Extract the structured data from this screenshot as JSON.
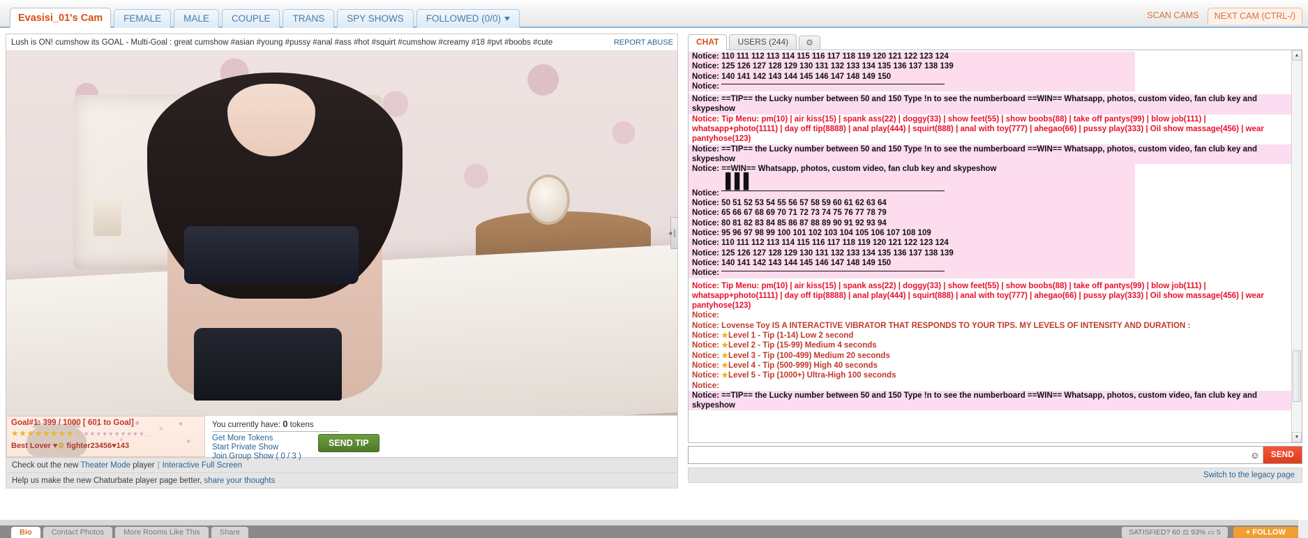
{
  "topbar": {
    "room_tab": "Evasisi_01's Cam",
    "category_tabs": [
      "FEMALE",
      "MALE",
      "COUPLE",
      "TRANS",
      "SPY SHOWS"
    ],
    "followed_tab": "FOLLOWED (0/0)",
    "scan_cams": "SCAN CAMS",
    "next_cam": "NEXT CAM (CTRL-/)"
  },
  "player": {
    "room_subject": "Lush is ON! cumshow its GOAL - Multi-Goal : great cumshow #asian #young #pussy #anal #ass #hot #squirt #cumshow #creamy #18 #pvt #boobs #cute",
    "report_abuse": "REPORT ABUSE",
    "resize_handle_glyph": "◄║►"
  },
  "goal": {
    "label": "Goal#1: 399 / 1000 [ 601 to Goal]",
    "current": 399,
    "target": 1000,
    "remaining": 601,
    "stars_filled": 8,
    "stars_total": 9,
    "stars_text": "★★★★★★★★☆",
    "stars_trail": "▾ ▾ ▾ ▾ ▾ ▾ ▾ ▾ ▾ ▾ ...",
    "best_lover_prefix": "Best Lover ♥",
    "best_lover_crown": "♔",
    "best_lover_name": "fighter23456♥143"
  },
  "tokens": {
    "balance_prefix": "You currently have:",
    "balance": "0",
    "balance_suffix": "tokens",
    "links": [
      "Get More Tokens",
      "Start Private Show",
      "Join Group Show ( 0 / 3 )"
    ],
    "send_tip": "SEND TIP"
  },
  "footer": {
    "theater_prefix": "Check out the new",
    "theater_link": "Theater Mode",
    "theater_suffix": "player",
    "separator": "|",
    "fullscreen_link": "Interactive Full Screen",
    "feedback_prefix": "Help us make the new Chaturbate player page better,",
    "feedback_link": "share your thoughts",
    "switch_legacy": "Switch to the legacy page"
  },
  "chat": {
    "tabs": [
      {
        "label": "CHAT",
        "active": true
      },
      {
        "label": "USERS (244)",
        "active": false
      }
    ],
    "settings_icon": "gear-icon",
    "user_count": 244,
    "input_placeholder": "",
    "input_value": "",
    "emoji_label": "☺",
    "send_label": "SEND",
    "messages": [
      {
        "style": "notice-pink",
        "text": "Notice: 110 111 112 113 114 115 116 117 118 119 120 121 122 123 124"
      },
      {
        "style": "notice-pink",
        "text": "Notice: 125 126 127 128 129 130 131 132 133 134 135 136 137 138 139"
      },
      {
        "style": "notice-pink",
        "text": "Notice: 140 141 142 143 144 145 146 147 148 149 150"
      },
      {
        "style": "notice-pink-rule",
        "text": "Notice:"
      },
      {
        "style": "spacer",
        "text": ""
      },
      {
        "style": "notice-pink-wide",
        "text": "Notice: ==TIP== the Lucky number between 50 and 150     Type !n to see the numberboard     ==WIN== Whatsapp, photos, custom video, fan club key and skypeshow"
      },
      {
        "style": "tipmenu",
        "text": "Notice: Tip Menu: pm(10) | air kiss(15) | spank ass(22) | doggy(33) | show feet(55) | show boobs(88) | take off pantys(99) | blow job(111) | whatsapp+photo(1111) | day off tip(8888) | anal play(444) | squirt(888) | anal with toy(777) | ahegao(66) | pussy play(333) | Oil show massage(456) | wear pantyhose(123)"
      },
      {
        "style": "notice-pink-wide",
        "text": "Notice: ==TIP== the Lucky number between 50 and 150     Type !n to see the numberboard     ==WIN== Whatsapp, photos, custom video, fan club key and skypeshow"
      },
      {
        "style": "notice-pink",
        "text": "Notice: ==WIN== Whatsapp, photos, custom video, fan club key and skypeshow"
      },
      {
        "style": "notice-pink-bars",
        "text": "Notice:"
      },
      {
        "style": "notice-pink-rule",
        "text": "Notice:"
      },
      {
        "style": "notice-pink",
        "text": "Notice: 50 51 52 53 54 55 56 57 58 59 60 61 62 63 64"
      },
      {
        "style": "notice-pink",
        "text": "Notice: 65 66 67 68 69 70 71 72 73 74 75 76 77 78 79"
      },
      {
        "style": "notice-pink",
        "text": "Notice: 80 81 82 83 84 85 86 87 88 89 90 91 92 93 94"
      },
      {
        "style": "notice-pink",
        "text": "Notice: 95 96 97 98 99 100 101 102 103 104 105 106 107 108 109"
      },
      {
        "style": "notice-pink",
        "text": "Notice: 110 111 112 113 114 115 116 117 118 119 120 121 122 123 124"
      },
      {
        "style": "notice-pink",
        "text": "Notice: 125 126 127 128 129 130 131 132 133 134 135 136 137 138 139"
      },
      {
        "style": "notice-pink",
        "text": "Notice: 140 141 142 143 144 145 146 147 148 149 150"
      },
      {
        "style": "notice-pink-rule",
        "text": "Notice:"
      },
      {
        "style": "spacer",
        "text": ""
      },
      {
        "style": "tipmenu",
        "text": "Notice: Tip Menu: pm(10) | air kiss(15) | spank ass(22) | doggy(33) | show feet(55) | show boobs(88) | take off pantys(99) | blow job(111) | whatsapp+photo(1111) | day off tip(8888) | anal play(444) | squirt(888) | anal with toy(777) | ahegao(66) | pussy play(333) | Oil show massage(456) | wear pantyhose(123)"
      },
      {
        "style": "lovense",
        "text": "Notice:"
      },
      {
        "style": "lovense",
        "text": "Notice: Lovense Toy IS A INTERACTIVE VIBRATOR THAT RESPONDS TO YOUR TIPS. MY LEVELS OF INTENSITY AND DURATION :"
      },
      {
        "style": "lovense-star",
        "text": "Notice: ★Level 1 - Tip (1-14) Low 2 second"
      },
      {
        "style": "lovense-star",
        "text": "Notice: ★Level 2 - Tip (15-99) Medium 4 seconds"
      },
      {
        "style": "lovense-star",
        "text": "Notice: ★Level 3 - Tip (100-499) Medium 20 seconds"
      },
      {
        "style": "lovense-star",
        "text": "Notice: ★Level 4 - Tip (500-999) High 40 seconds"
      },
      {
        "style": "lovense-star",
        "text": "Notice: ★Level 5 - Tip (1000+) Ultra-High 100 seconds"
      },
      {
        "style": "lovense",
        "text": "Notice:"
      },
      {
        "style": "notice-pink-wide",
        "text": "Notice: ==TIP== the Lucky number between 50 and 150     Type !n to see the numberboard     ==WIN== Whatsapp, photos, custom video, fan club key and skypeshow"
      }
    ]
  },
  "bottom_strip": {
    "tabs": [
      "Bio",
      "Contact Photos",
      "More Rooms Like This",
      "Share"
    ],
    "satisfaction": "SATISFIED? 60  ⚖ 93%  ▭ 5",
    "follow": "+ FOLLOW"
  }
}
